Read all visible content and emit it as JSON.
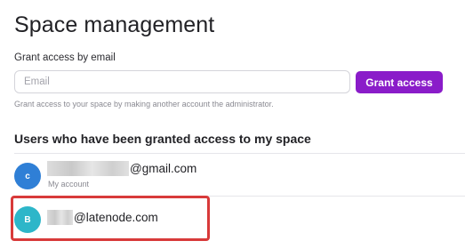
{
  "page": {
    "title": "Space management"
  },
  "grant": {
    "label": "Grant access by email",
    "placeholder": "Email",
    "button_label": "Grant access",
    "help_text": "Grant access to your space by making another account the administrator.",
    "button_color": "#8a1cc9"
  },
  "users": {
    "section_title": "Users who have been granted access to my space",
    "items": [
      {
        "avatar_letter": "c",
        "avatar_color": "#2f7fd6",
        "email_visible": "@gmail.com",
        "email_redacted": true,
        "sub_label": "My account"
      },
      {
        "avatar_letter": "B",
        "avatar_color": "#2db6c9",
        "email_visible": "@latenode.com",
        "email_redacted": true,
        "sub_label": ""
      }
    ]
  },
  "annotation": {
    "highlight_color": "#d83a3a"
  }
}
